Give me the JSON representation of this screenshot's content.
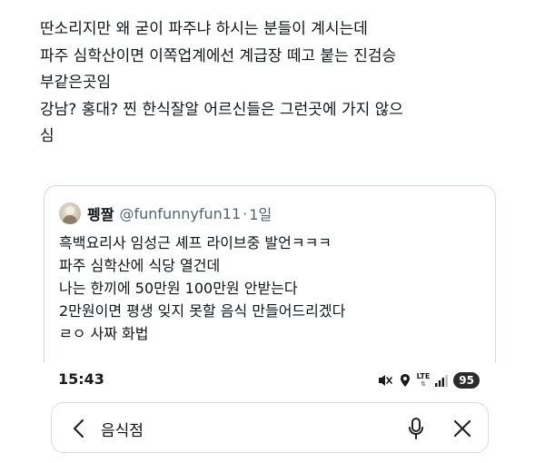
{
  "tweet": {
    "lines": [
      "딴소리지만 왜 굳이 파주냐 하시는 분들이 계시는데",
      "파주 심학산이면 이쪽업계에선 계급장 떼고 붙는 진검승",
      "부같은곳임",
      "강남? 홍대? 찐 한식잘알 어르신들은 그런곳에 가지 않으",
      "심"
    ]
  },
  "quote": {
    "author_name": "펭짤",
    "handle": "@funfunnyfun11",
    "separator": "·",
    "time": "1일",
    "lines": [
      "흑백요리사 임성근 셰프 라이브중 발언ㅋㅋㅋ",
      "파주 심학산에 식당 열건데",
      "나는 한끼에 50만원 100만원 안받는다",
      "2만원이면 평생 잊지 못할 음식 만들어드리겠다",
      "ㄹㅇ 사짜 화법"
    ]
  },
  "status_bar": {
    "time": "15:43",
    "network": "LTE",
    "battery": "95",
    "icons": [
      "mute-icon",
      "location-icon",
      "lte-icon",
      "signal-icon",
      "battery-icon"
    ]
  },
  "search": {
    "value": "음식점",
    "icons": [
      "back-arrow-icon",
      "microphone-icon",
      "close-icon"
    ]
  }
}
